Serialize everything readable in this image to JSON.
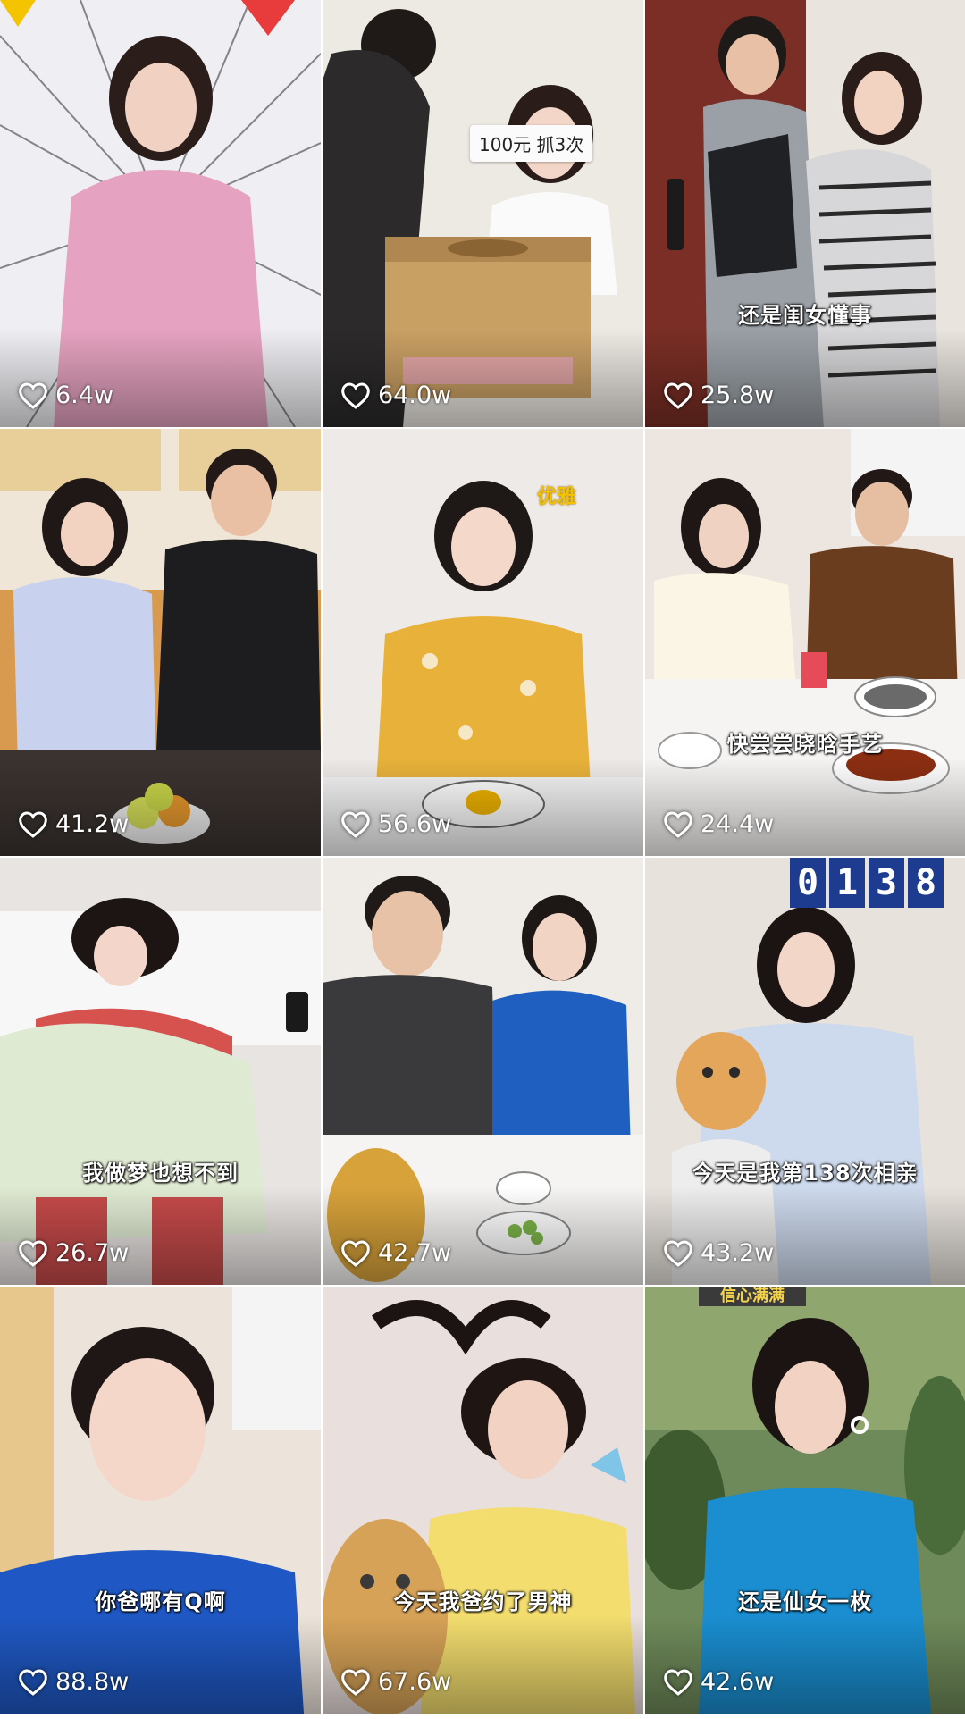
{
  "videos": [
    {
      "likes": "6.4w",
      "caption": ""
    },
    {
      "likes": "64.0w",
      "caption": ""
    },
    {
      "likes": "25.8w",
      "caption": "还是闺女懂事"
    },
    {
      "likes": "41.2w",
      "caption": ""
    },
    {
      "likes": "56.6w",
      "caption": ""
    },
    {
      "likes": "24.4w",
      "caption": "快尝尝晓晗手艺"
    },
    {
      "likes": "26.7w",
      "caption": "我做梦也想不到"
    },
    {
      "likes": "42.7w",
      "caption": ""
    },
    {
      "likes": "43.2w",
      "caption": "今天是我第138次相亲"
    },
    {
      "likes": "88.8w",
      "caption": "你爸哪有Q啊"
    },
    {
      "likes": "67.6w",
      "caption": "今天我爸约了男神"
    },
    {
      "likes": "42.6w",
      "caption": "还是仙女一枚"
    }
  ],
  "in_video_text": {
    "v2_note": "100元 抓3次",
    "v5_sticker": "优雅",
    "v9_scoreboard": [
      "0",
      "1",
      "3",
      "8"
    ],
    "v12_sign": "信心满满"
  },
  "icons": {
    "like": "heart-outline-icon"
  },
  "colors": {
    "text": "#ffffff",
    "background": "#ffffff"
  }
}
